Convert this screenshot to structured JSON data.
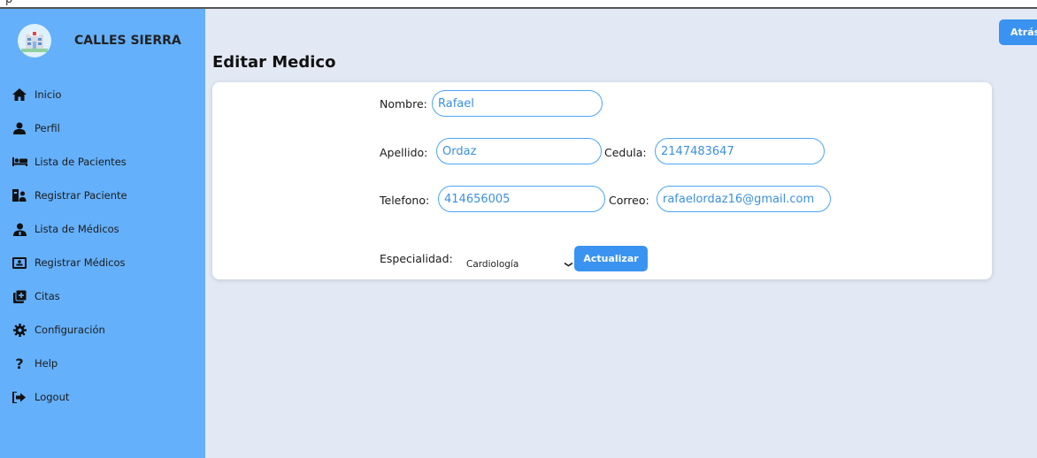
{
  "top": {
    "text": "p"
  },
  "brand": {
    "name": "CALLES SIERRA",
    "logo_icon": "hospital-icon"
  },
  "sidebar": {
    "items": [
      {
        "label": "Inicio",
        "icon": "home-icon"
      },
      {
        "label": "Perfil",
        "icon": "user-icon"
      },
      {
        "label": "Lista de Pacientes",
        "icon": "bed-icon"
      },
      {
        "label": "Registrar Paciente",
        "icon": "user-plus-icon"
      },
      {
        "label": "Lista de Médicos",
        "icon": "doctor-icon"
      },
      {
        "label": "Registrar Médicos",
        "icon": "id-card-icon"
      },
      {
        "label": "Citas",
        "icon": "calendar-plus-icon"
      },
      {
        "label": "Configuración",
        "icon": "gear-icon"
      },
      {
        "label": "Help",
        "icon": "question-icon"
      },
      {
        "label": "Logout",
        "icon": "logout-icon"
      }
    ]
  },
  "page": {
    "title": "Editar Medico",
    "back_label": "Atrás"
  },
  "form": {
    "nombre": {
      "label": "Nombre:",
      "value": "Rafael"
    },
    "apellido": {
      "label": "Apellido:",
      "value": "Ordaz"
    },
    "cedula": {
      "label": "Cedula:",
      "value": "2147483647"
    },
    "telefono": {
      "label": "Telefono:",
      "value": "414656005"
    },
    "correo": {
      "label": "Correo:",
      "value": "rafaelordaz16@gmail.com"
    },
    "especialidad": {
      "label": "Especialidad:",
      "value": "Cardiología"
    },
    "submit_label": "Actualizar"
  },
  "colors": {
    "sidebar": "#64b0fb",
    "accent": "#3a93f0",
    "background": "#e3e9f4",
    "input_border": "#49a5f7"
  }
}
